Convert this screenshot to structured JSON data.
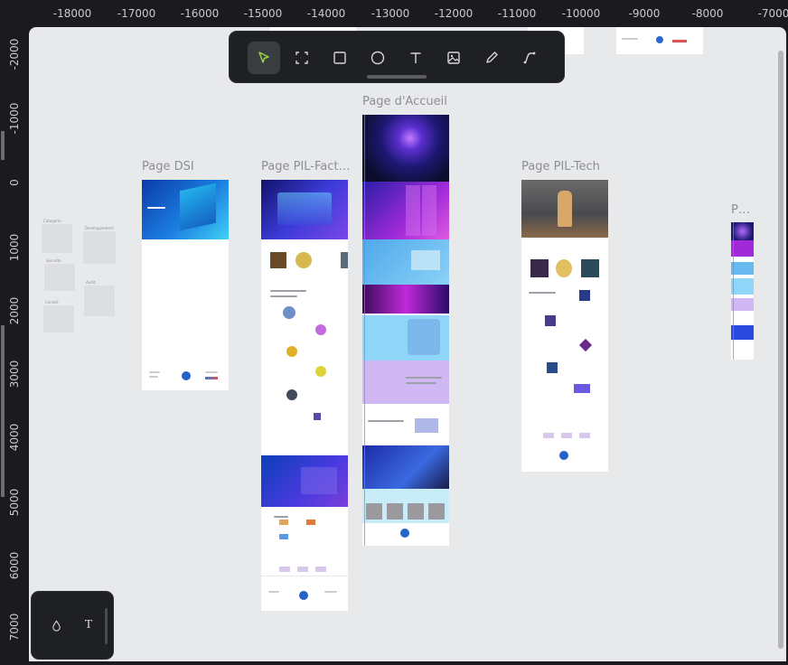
{
  "ruler": {
    "x_ticks": [
      "-18000",
      "-17000",
      "-16000",
      "-15000",
      "-14000",
      "-13000",
      "-12000",
      "-11000",
      "-10000",
      "-9000",
      "-8000",
      "-7000"
    ],
    "y_ticks": [
      "-2000",
      "-1000",
      "0",
      "1000",
      "2000",
      "3000",
      "4000",
      "5000",
      "6000",
      "7000"
    ]
  },
  "boards": {
    "dsi": "Page DSI",
    "pil_fact": "Page PIL-Fact…",
    "accueil": "Page d'Accueil",
    "pil_tech": "Page PIL-Tech",
    "partial": "P…"
  },
  "toolbar": {
    "tools": [
      {
        "name": "select-tool",
        "icon": "pointer-icon",
        "active": true
      },
      {
        "name": "frame-tool",
        "icon": "frame-icon",
        "active": false
      },
      {
        "name": "rectangle-tool",
        "icon": "rectangle-icon",
        "active": false
      },
      {
        "name": "ellipse-tool",
        "icon": "ellipse-icon",
        "active": false
      },
      {
        "name": "text-tool",
        "icon": "text-icon",
        "active": false
      },
      {
        "name": "image-tool",
        "icon": "image-icon",
        "active": false
      },
      {
        "name": "pen-tool",
        "icon": "pen-icon",
        "active": false
      },
      {
        "name": "path-tool",
        "icon": "path-icon",
        "active": false
      }
    ]
  },
  "palette": {
    "color_icon": "drop-icon",
    "text_label": "T"
  },
  "colors": {
    "accent_select": "#9ad14a",
    "canvas": "#e8e9eb",
    "chrome": "#1b1b1f"
  }
}
